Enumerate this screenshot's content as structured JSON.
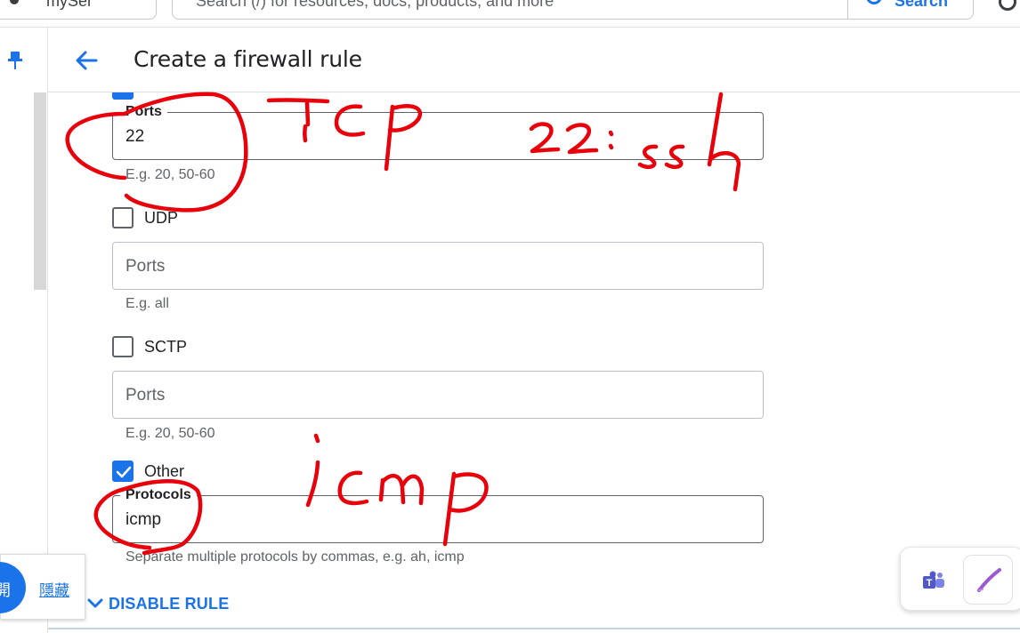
{
  "topbar": {
    "project_name": "mySer",
    "search_placeholder": "Search (/) for resources, docs, products, and more",
    "search_button_label": "Search"
  },
  "header": {
    "title": "Create a firewall rule"
  },
  "form": {
    "tcp_ports": {
      "label": "Ports",
      "value": "22",
      "hint": "E.g. 20, 50-60"
    },
    "udp": {
      "label": "UDP",
      "checked": false,
      "ports_placeholder": "Ports",
      "hint": "E.g. all"
    },
    "sctp": {
      "label": "SCTP",
      "checked": false,
      "ports_placeholder": "Ports",
      "hint": "E.g. 20, 50-60"
    },
    "other": {
      "label": "Other",
      "checked": true,
      "protocols_label": "Protocols",
      "protocols_value": "icmp",
      "hint": "Separate multiple protocols by commas, e.g. ah, icmp"
    },
    "disable_rule_label": "DISABLE RULE"
  },
  "hide_popup": {
    "circle_char": "開",
    "hide_label": "隱藏"
  },
  "annotations": {
    "ink_color": "#e8000b",
    "texts": [
      "TCP",
      "22 : ssh",
      "icmp"
    ]
  },
  "colors": {
    "accent": "#1a73e8",
    "teams": "#5059c9",
    "pen": "#9b59d6"
  }
}
